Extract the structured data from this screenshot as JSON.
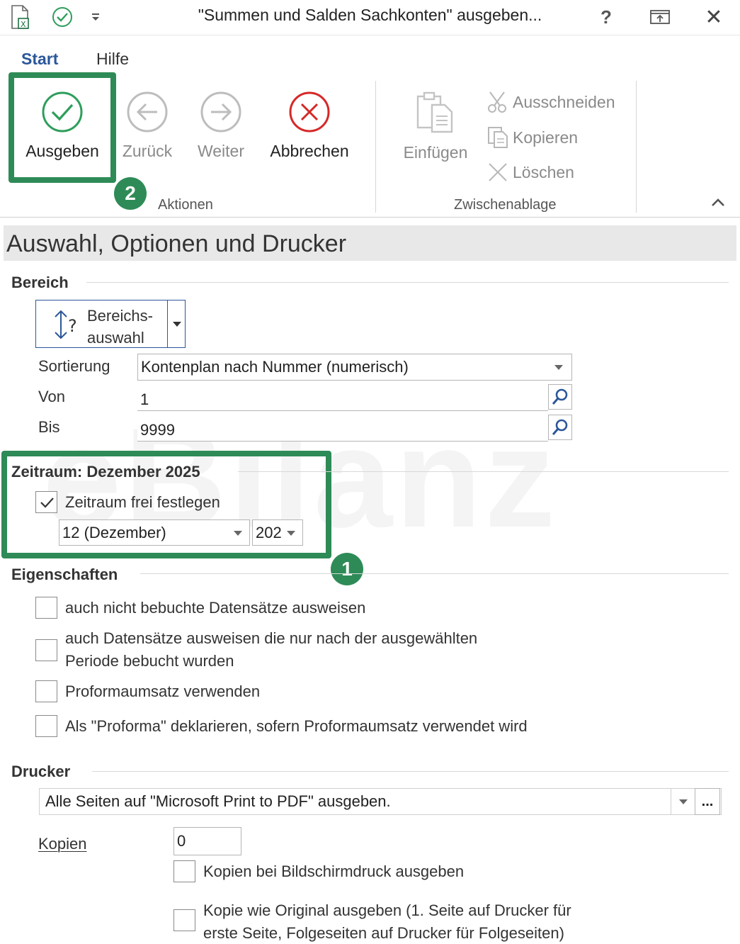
{
  "window": {
    "title": "\"Summen und Salden Sachkonten\" ausgeben...",
    "help": "?",
    "close": "✕"
  },
  "ribbon": {
    "tabs": [
      {
        "label": "Start",
        "active": true
      },
      {
        "label": "Hilfe",
        "active": false
      }
    ],
    "aktionen": {
      "label": "Aktionen",
      "buttons": [
        {
          "label": "Ausgeben",
          "enabled": true,
          "icon": "check-circle-icon"
        },
        {
          "label": "Zurück",
          "enabled": false,
          "icon": "arrow-left-circle-icon"
        },
        {
          "label": "Weiter",
          "enabled": false,
          "icon": "arrow-right-circle-icon"
        },
        {
          "label": "Abbrechen",
          "enabled": true,
          "icon": "cancel-circle-icon"
        }
      ]
    },
    "zwischenablage": {
      "label": "Zwischenablage",
      "paste": "Einfügen",
      "cut": "Ausschneiden",
      "copy": "Kopieren",
      "delete": "Löschen"
    },
    "badge_2": "2"
  },
  "section_title": "Auswahl, Optionen und Drucker",
  "watermark": "eBilanz",
  "bereich": {
    "title": "Bereich",
    "range_button_line1": "Bereichs-",
    "range_button_line2": "auswahl",
    "sortierung_label": "Sortierung",
    "sortierung_value": "Kontenplan nach Nummer (numerisch)",
    "von_label": "Von",
    "von_value": "1",
    "bis_label": "Bis",
    "bis_value": "9999"
  },
  "zeitraum": {
    "title": "Zeitraum: Dezember 2025",
    "checkbox_label": "Zeitraum frei festlegen",
    "checked": true,
    "month_value": "12  (Dezember)",
    "year_value": "202",
    "badge_1": "1"
  },
  "eigenschaften": {
    "title": "Eigenschaften",
    "options": [
      {
        "line1": "auch nicht bebuchte Datensätze ausweisen",
        "line2": "",
        "checked": false
      },
      {
        "line1": "auch Datensätze ausweisen die nur nach der ausgewählten",
        "line2": "Periode bebucht wurden",
        "checked": false
      },
      {
        "line1": "Proformaumsatz verwenden",
        "line2": "",
        "checked": false
      },
      {
        "line1": "Als \"Proforma\" deklarieren, sofern Proformaumsatz verwendet wird",
        "line2": "",
        "checked": false
      }
    ]
  },
  "drucker": {
    "title": "Drucker",
    "printer_value": "Alle Seiten auf \"Microsoft Print to PDF\" ausgeben.",
    "more_button": "...",
    "kopien_label": "Kopien",
    "kopien_value": "0",
    "opt1": "Kopien bei Bildschirmdruck ausgeben",
    "opt2_line1": "Kopie wie Original ausgeben (1. Seite auf Drucker für",
    "opt2_line2": "erste Seite, Folgeseiten auf Drucker für Folgeseiten)"
  },
  "colors": {
    "highlight_green": "#2e8b57",
    "accent_blue": "#2b579a",
    "cancel_red": "#d62828"
  }
}
